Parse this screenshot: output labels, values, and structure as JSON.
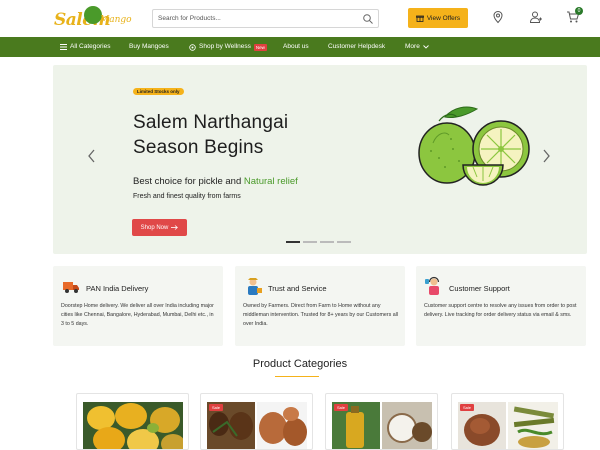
{
  "logo": {
    "text": "Salem",
    "sub": "Mango"
  },
  "search": {
    "placeholder": "Search for Products..."
  },
  "header": {
    "offers_label": "View Offers",
    "cart_count": "0"
  },
  "nav": {
    "all_categories": "All Categories",
    "buy_mangoes": "Buy Mangoes",
    "shop_by_wellness": "Shop by Wellness",
    "new_badge": "New",
    "about_us": "About us",
    "customer_helpdesk": "Customer Helpdesk",
    "more": "More"
  },
  "hero": {
    "badge": "Limited Stocks only",
    "title_line1": "Salem Narthangai",
    "title_line2": "Season Begins",
    "subtitle_pre": "Best choice for pickle and ",
    "subtitle_highlight": "Natural relief",
    "tagline": "Fresh and finest quality from farms",
    "cta": "Shop Now",
    "slides": 4,
    "active_slide": 1
  },
  "features": [
    {
      "title": "PAN India Delivery",
      "desc": "Doorstep Home delivery. We deliver all over India including major cities like Chennai, Bangalore, Hyderabad, Mumbai, Delhi etc., in 3 to 5 days.",
      "icon": "delivery-icon"
    },
    {
      "title": "Trust and Service",
      "desc": "Owned by Farmers. Direct from Farm to Home without any middleman intervention. Trusted for 8+ years by our Customers all over India.",
      "icon": "farmer-icon"
    },
    {
      "title": "Customer Support",
      "desc": "Customer support centre to resolve any issues from order to post delivery. Live tracking for order delivery status via email & sms.",
      "icon": "support-icon"
    }
  ],
  "categories": {
    "heading": "Product Categories",
    "sale_label": "Sale"
  },
  "colors": {
    "brand_green": "#4a7a1e",
    "accent_yellow": "#f5b21a",
    "cta_red": "#e04848"
  }
}
